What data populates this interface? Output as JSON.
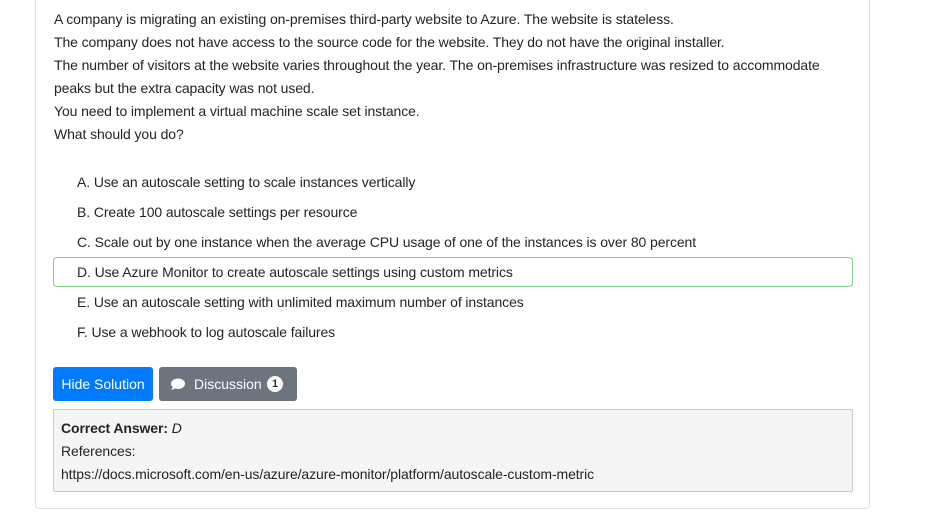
{
  "question": {
    "lines": [
      "A company is migrating an existing on-premises third-party website to Azure. The website is stateless.",
      "The company does not have access to the source code for the website. They do not have the original installer.",
      "The number of visitors at the website varies throughout the year. The on-premises infrastructure was resized to accommodate peaks but the extra capacity was not used.",
      "You need to implement a virtual machine scale set instance.",
      "What should you do?"
    ]
  },
  "choices": [
    "A. Use an autoscale setting to scale instances vertically",
    "B. Create 100 autoscale settings per resource",
    "C. Scale out by one instance when the average CPU usage of one of the instances is over 80 percent",
    "D. Use Azure Monitor to create autoscale settings using custom metrics",
    "E. Use an autoscale setting with unlimited maximum number of instances",
    "F. Use a webhook to log autoscale failures"
  ],
  "buttons": {
    "hide_solution": "Hide Solution",
    "discussion": "Discussion",
    "discussion_count": "1"
  },
  "answer": {
    "label": "Correct Answer:",
    "value": "D",
    "references_label": "References:",
    "reference_url": "https://docs.microsoft.com/en-us/azure/azure-monitor/platform/autoscale-custom-metric"
  },
  "colors": {
    "primary": "#007bff",
    "secondary": "#6c757d",
    "correct_border": "#7fd18b"
  },
  "icons": {
    "discussion": "chat-bubble-icon"
  }
}
